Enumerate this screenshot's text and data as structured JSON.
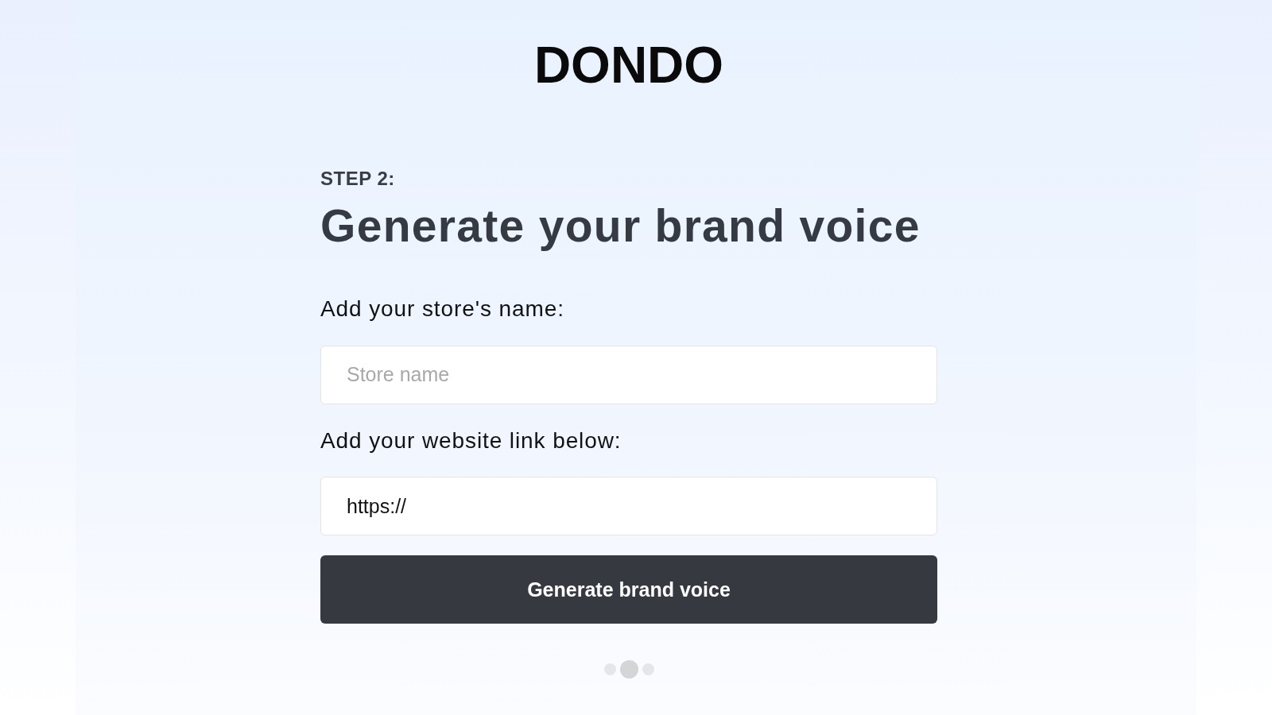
{
  "logo": {
    "text": "DONDO"
  },
  "step_label": "STEP 2:",
  "title": "Generate your brand voice",
  "fields": [
    {
      "label": "Add your store's name:",
      "placeholder": "Store name"
    },
    {
      "label": "Add your website link below:",
      "value": "https://"
    }
  ],
  "button": {
    "label": "Generate brand voice"
  },
  "steps": [
    {
      "selected": false
    },
    {
      "selected": true
    },
    {
      "selected": false
    }
  ]
}
